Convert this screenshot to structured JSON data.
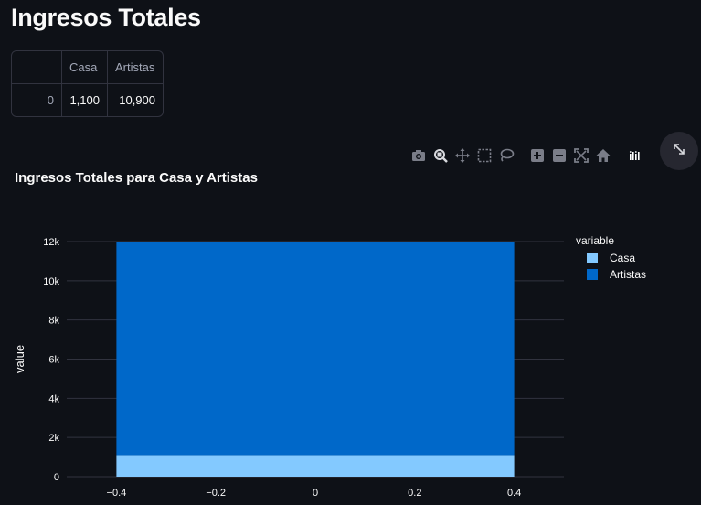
{
  "page": {
    "title": "Ingresos Totales"
  },
  "dataframe": {
    "columns": [
      "",
      "Casa",
      "Artistas"
    ],
    "rows": [
      [
        "0",
        "1,100",
        "10,900"
      ]
    ]
  },
  "chart_data": {
    "type": "bar",
    "stacked": true,
    "title": "Ingresos Totales para Casa y Artistas",
    "xlabel": "",
    "ylabel": "value",
    "x": [
      0
    ],
    "bar_width": 0.8,
    "series": [
      {
        "name": "Casa",
        "values": [
          1100
        ],
        "color": "#83c9ff"
      },
      {
        "name": "Artistas",
        "values": [
          10900
        ],
        "color": "#0068c9"
      }
    ],
    "xlim": [
      -0.5,
      0.5
    ],
    "ylim": [
      0,
      12000
    ],
    "xticks": [
      "−0.4",
      "−0.2",
      "0",
      "0.2",
      "0.4"
    ],
    "yticks": [
      "0",
      "2k",
      "4k",
      "6k",
      "8k",
      "10k",
      "12k"
    ],
    "legend_title": "variable",
    "legend_position": "right",
    "grid": true,
    "colors": {
      "background": "#0e1117",
      "grid": "#31333f",
      "text": "#fafafa",
      "muted": "#a3a8b8",
      "toolbar": "#7a7d88"
    }
  },
  "toolbar": {
    "icons": [
      "camera-icon",
      "zoom-icon",
      "pan-icon",
      "box-select-icon",
      "lasso-icon",
      "zoom-in-icon",
      "zoom-out-icon",
      "autoscale-icon",
      "reset-axes-icon",
      "plotly-logo-icon"
    ],
    "fullscreen_icon": "expand-icon"
  }
}
